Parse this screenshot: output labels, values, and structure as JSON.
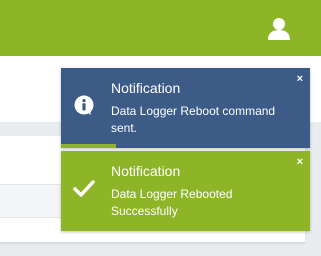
{
  "header": {
    "user_icon": "user-icon"
  },
  "notifications": [
    {
      "type": "info",
      "icon": "info-icon",
      "title": "Notification",
      "message": "Data Logger Reboot command sent.",
      "close": "×",
      "progress": 0.22
    },
    {
      "type": "success",
      "icon": "checkmark-icon",
      "title": "Notification",
      "message": "Data Logger Rebooted Successfully",
      "close": "×"
    }
  ],
  "colors": {
    "header_bg": "#8db527",
    "info_bg": "#3c5b87",
    "success_bg": "#8db527",
    "page_bg": "#e9ecef"
  }
}
